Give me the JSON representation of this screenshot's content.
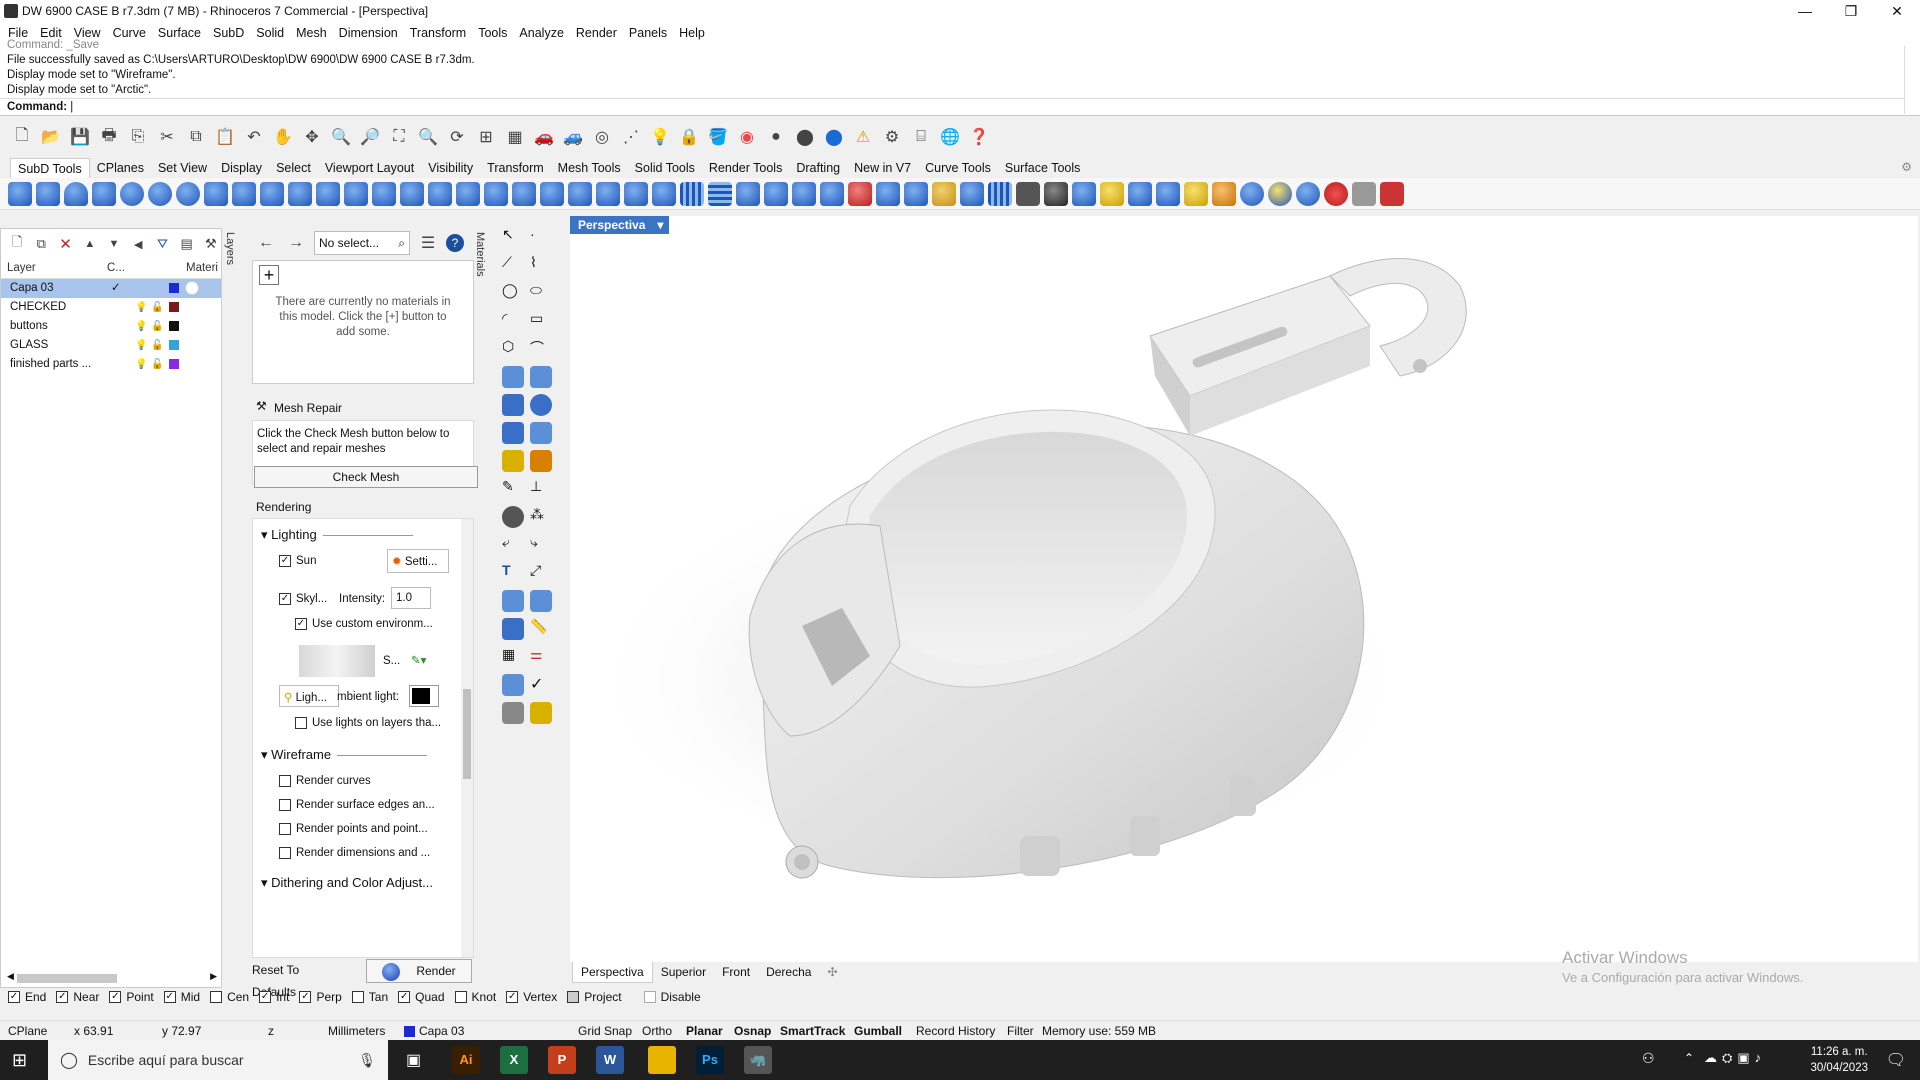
{
  "window": {
    "title": "DW 6900 CASE B r7.3dm (7 MB) - Rhinoceros 7 Commercial - [Perspectiva]",
    "minimize": "—",
    "maximize": "❐",
    "close": "✕"
  },
  "menu": [
    "File",
    "Edit",
    "View",
    "Curve",
    "Surface",
    "SubD",
    "Solid",
    "Mesh",
    "Dimension",
    "Transform",
    "Tools",
    "Analyze",
    "Render",
    "Panels",
    "Help"
  ],
  "command": {
    "history": [
      "Command: _Save",
      "File successfully saved as C:\\Users\\ARTURO\\Desktop\\DW 6900\\DW 6900 CASE B r7.3dm.",
      "Display mode set to \"Wireframe\".",
      "Display mode set to \"Arctic\"."
    ],
    "prompt": "Command:"
  },
  "toolbar_tabs": [
    "SubD Tools",
    "CPlanes",
    "Set View",
    "Display",
    "Select",
    "Viewport Layout",
    "Visibility",
    "Transform",
    "Mesh Tools",
    "Solid Tools",
    "Render Tools",
    "Drafting",
    "New in V7",
    "Curve Tools",
    "Surface Tools"
  ],
  "layers": {
    "headers": {
      "layer": "Layer",
      "cplane": "C...",
      "material": "Materi"
    },
    "rows": [
      {
        "name": "Capa 03",
        "check": "✓",
        "color": "#1a2bd6",
        "selected": true
      },
      {
        "name": "CHECKED",
        "color": "#7a1a1a"
      },
      {
        "name": "buttons",
        "color": "#111111"
      },
      {
        "name": "GLASS",
        "color": "#3aa0d8"
      },
      {
        "name": "finished parts ...",
        "color": "#8a2be2"
      }
    ],
    "tab_label": "Layers"
  },
  "materials": {
    "selector": "No select...",
    "empty_text": "There are currently no materials in this model. Click the [+] button to add some.",
    "tab_label": "Materials"
  },
  "mesh_repair": {
    "title": "Mesh Repair",
    "text": "Click the Check Mesh button below to select and repair meshes",
    "button": "Check Mesh"
  },
  "rendering": {
    "header": "Rendering",
    "lighting": "Lighting",
    "sun": "Sun",
    "sun_settings": "Setti...",
    "skylight": "Skyl...",
    "intensity_label": "Intensity:",
    "intensity": "1.0",
    "custom_env": "Use custom environm...",
    "env_short": "S...",
    "light_btn": "Ligh...",
    "ambient": "mbient light:",
    "use_layers": "Use lights on layers tha...",
    "wireframe": "Wireframe",
    "render_curves": "Render curves",
    "render_edges": "Render surface edges an...",
    "render_points": "Render points and point...",
    "render_dims": "Render dimensions and ...",
    "dithering": "Dithering and Color Adjust...",
    "reset": "Reset To Defaults",
    "render": "Render"
  },
  "viewport": {
    "name": "Perspectiva",
    "tabs": [
      "Perspectiva",
      "Superior",
      "Front",
      "Derecha"
    ],
    "add": "✣"
  },
  "watermark": {
    "line1": "Activar Windows",
    "line2": "Ve a Configuración para activar Windows."
  },
  "osnaps": [
    {
      "label": "End",
      "checked": true
    },
    {
      "label": "Near",
      "checked": true
    },
    {
      "label": "Point",
      "checked": true
    },
    {
      "label": "Mid",
      "checked": true
    },
    {
      "label": "Cen",
      "checked": false
    },
    {
      "label": "Int",
      "checked": true
    },
    {
      "label": "Perp",
      "checked": true
    },
    {
      "label": "Tan",
      "checked": false
    },
    {
      "label": "Quad",
      "checked": true
    },
    {
      "label": "Knot",
      "checked": false
    },
    {
      "label": "Vertex",
      "checked": true
    },
    {
      "label": "Project",
      "checked": false
    },
    {
      "label": "Disable",
      "checked": false
    }
  ],
  "status": {
    "cplane": "CPlane",
    "x": "x 63.91",
    "y": "y 72.97",
    "z": "z",
    "units": "Millimeters",
    "layer": "Capa 03",
    "grid": "Grid Snap",
    "ortho": "Ortho",
    "planar": "Planar",
    "osnap": "Osnap",
    "smarttrack": "SmartTrack",
    "gumball": "Gumball",
    "history": "Record History",
    "filter": "Filter",
    "memory": "Memory use: 559 MB"
  },
  "taskbar": {
    "search_placeholder": "Escribe aquí para buscar",
    "time": "11:26 a. m.",
    "date": "30/04/2023"
  }
}
